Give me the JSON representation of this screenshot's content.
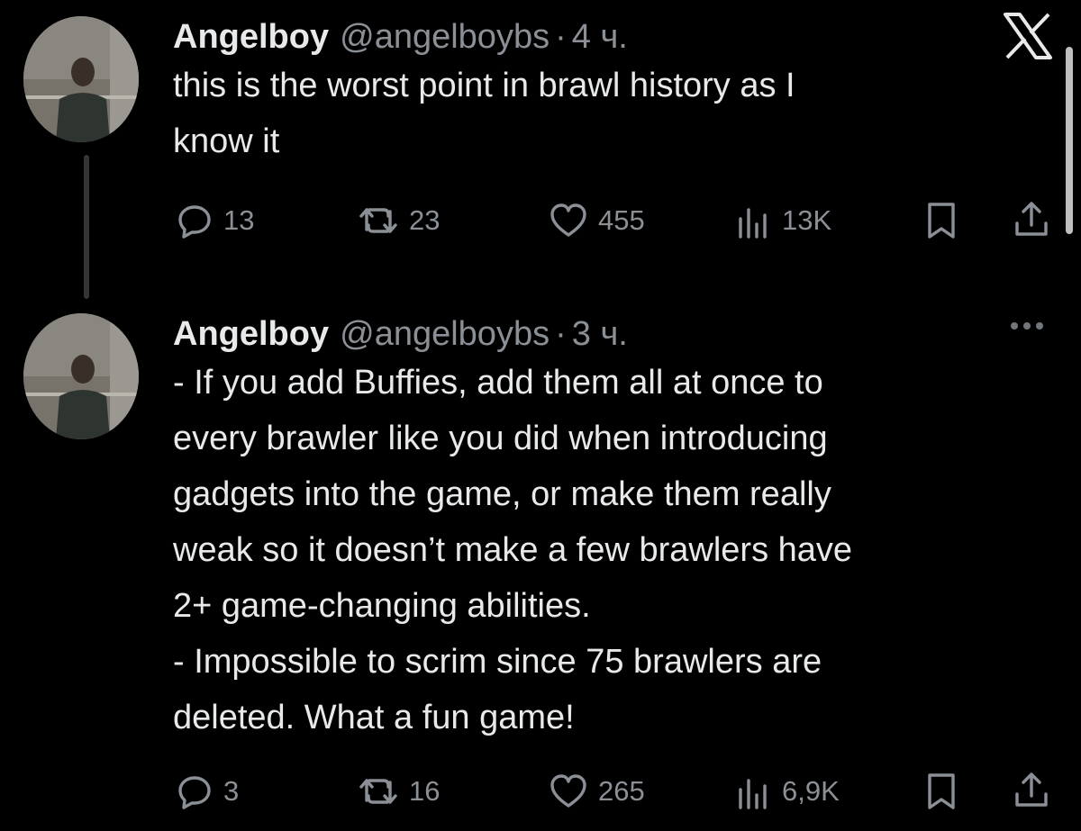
{
  "tweets": [
    {
      "name": "Angelboy",
      "handle": "@angelboybs",
      "separator": "·",
      "time": "4 ч.",
      "text_lines": [
        "this is the worst point in brawl history as I",
        "know it"
      ],
      "replies": "13",
      "reposts": "23",
      "likes": "455",
      "views": "13K"
    },
    {
      "name": "Angelboy",
      "handle": "@angelboybs",
      "separator": "·",
      "time": "3 ч.",
      "text_lines": [
        "- If you add Buffies, add them all at once to",
        "every brawler like you did when introducing",
        "gadgets into the game, or make them really",
        "weak so it doesn’t make a few brawlers have",
        "2+ game-changing abilities.",
        "- Impossible to scrim since 75 brawlers are",
        "deleted. What a fun game!"
      ],
      "replies": "3",
      "reposts": "16",
      "likes": "265",
      "views": "6,9K"
    }
  ],
  "icons": {
    "close": "x-close-icon",
    "more": "more-options-icon",
    "reply": "reply-icon",
    "repost": "repost-icon",
    "like": "heart-icon",
    "views": "views-icon",
    "bookmark": "bookmark-icon",
    "share": "share-icon"
  },
  "colors": {
    "background": "#000000",
    "text": "#e7e9ea",
    "secondary": "#8b9096"
  }
}
